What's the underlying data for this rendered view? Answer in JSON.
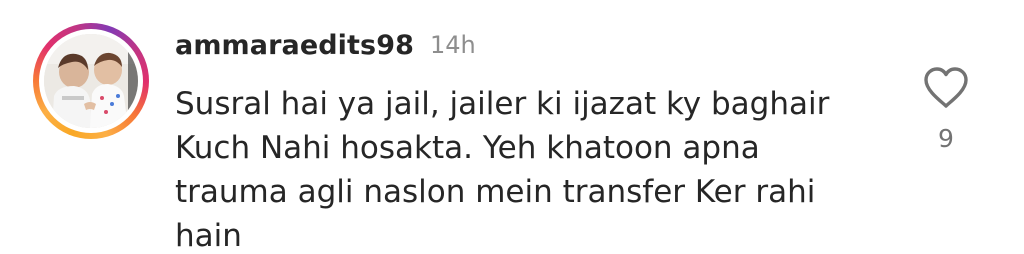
{
  "comment": {
    "username": "ammaraedits98",
    "timestamp": "14h",
    "text_lines": [
      "Susral hai ya jail, jailer ki ijazat ky baghair",
      "Kuch Nahi hosakta. Yeh khatoon apna",
      "trauma agli naslon mein transfer Ker rahi",
      "hain"
    ],
    "like_count": "9",
    "like_icon": "heart-outline-icon",
    "avatar_has_story_ring": true
  },
  "colors": {
    "text_primary": "#262626",
    "text_secondary": "#8e8e8e",
    "icon": "#737373",
    "background": "#ffffff"
  }
}
